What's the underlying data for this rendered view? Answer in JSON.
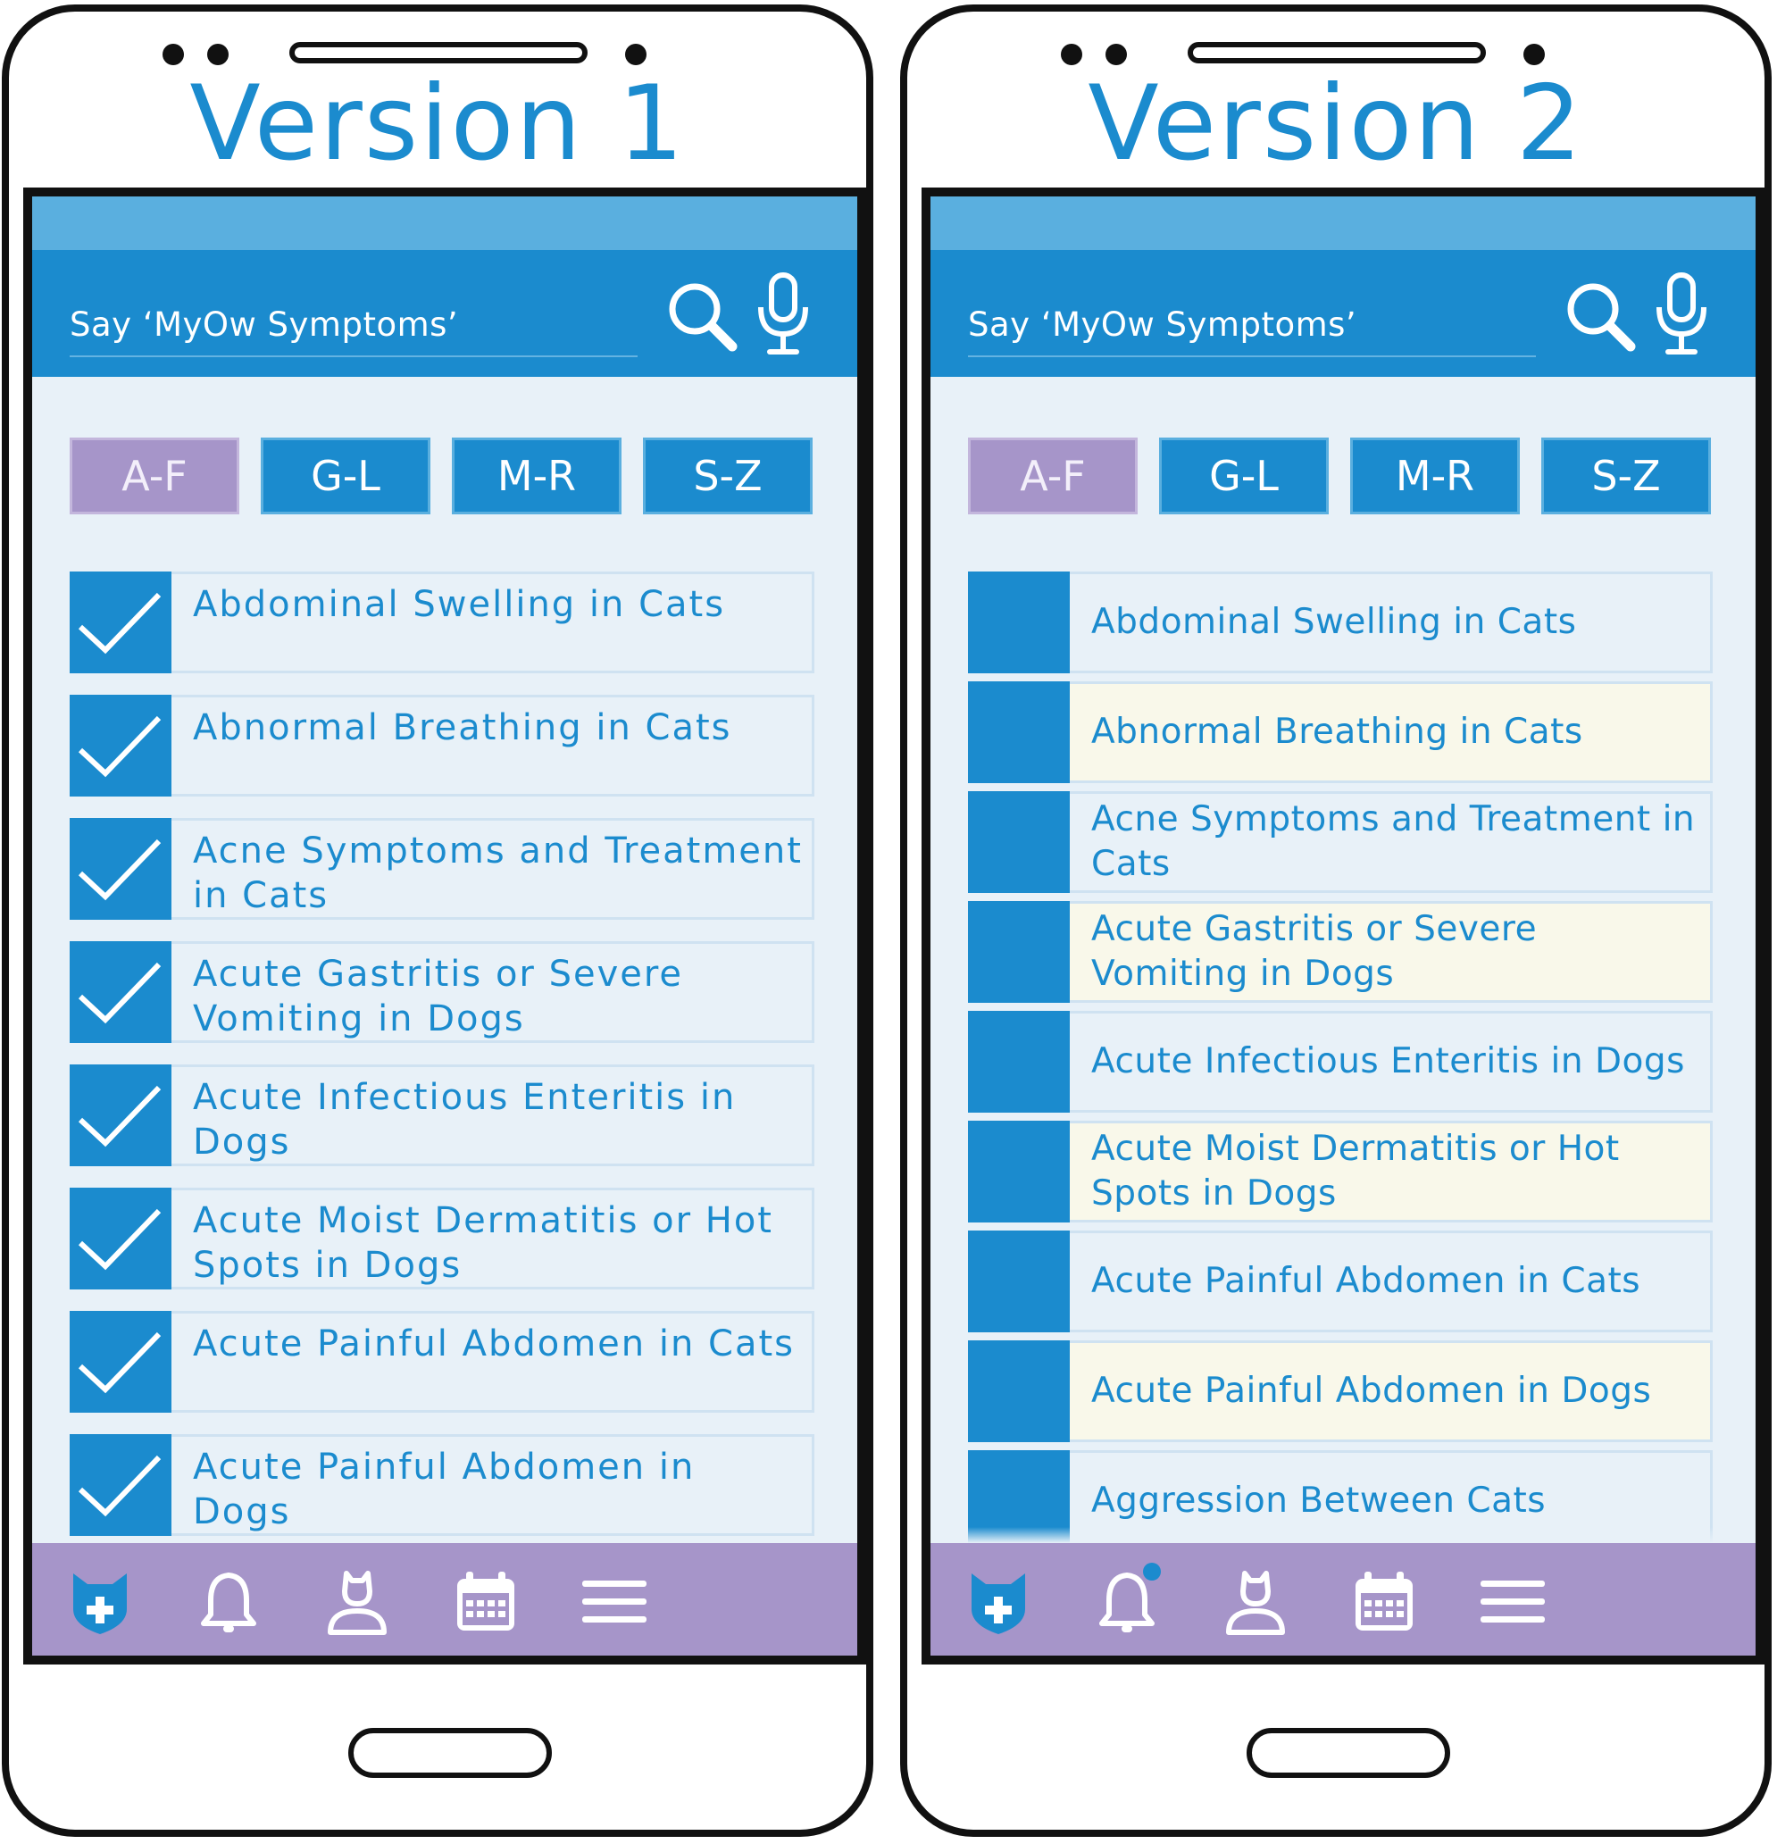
{
  "colors": {
    "brand_blue": "#1b8bce",
    "status_bar_blue": "#5aafdf",
    "list_background": "#e8f1f8",
    "highlight_row": "#f9f8ea",
    "nav_purple": "#a695c9",
    "active_tab_purple": "#a695c9"
  },
  "versions": [
    {
      "title": "Version 1",
      "search": {
        "label": "Say ‘MyOw Symptoms’",
        "search_icon": "search-icon",
        "mic_icon": "microphone-icon"
      },
      "tabs": [
        {
          "label": "A-F",
          "active": true
        },
        {
          "label": "G-L",
          "active": false
        },
        {
          "label": "M-R",
          "active": false
        },
        {
          "label": "S-Z",
          "active": false
        }
      ],
      "items": [
        {
          "label": "Abdominal Swelling in Cats",
          "checked": true
        },
        {
          "label": "Abnormal Breathing in Cats",
          "checked": true
        },
        {
          "label": "Acne Symptoms and Treatment in Cats",
          "checked": true
        },
        {
          "label": "Acute Gastritis or Severe Vomiting in Dogs",
          "checked": true
        },
        {
          "label": "Acute Infectious Enteritis in Dogs",
          "checked": true
        },
        {
          "label": "Acute Moist Dermatitis or Hot Spots in Dogs",
          "checked": true
        },
        {
          "label": "Acute Painful Abdomen in Cats",
          "checked": true
        },
        {
          "label": "Acute Painful Abdomen in Dogs",
          "checked": true
        }
      ],
      "nav": [
        "shield-plus-icon",
        "bell-icon",
        "profile-icon",
        "calendar-icon",
        "menu-icon"
      ]
    },
    {
      "title": "Version 2",
      "search": {
        "label": "Say ‘MyOw Symptoms’",
        "search_icon": "search-icon",
        "mic_icon": "microphone-icon"
      },
      "tabs": [
        {
          "label": "A-F",
          "active": true
        },
        {
          "label": "G-L",
          "active": false
        },
        {
          "label": "M-R",
          "active": false
        },
        {
          "label": "S-Z",
          "active": false
        }
      ],
      "items": [
        {
          "label": "Abdominal Swelling in Cats",
          "highlight": false
        },
        {
          "label": "Abnormal Breathing in Cats",
          "highlight": true
        },
        {
          "label": "Acne Symptoms and Treatment in Cats",
          "highlight": false
        },
        {
          "label": "Acute Gastritis or Severe Vomiting in Dogs",
          "highlight": true
        },
        {
          "label": "Acute Infectious Enteritis in Dogs",
          "highlight": false
        },
        {
          "label": "Acute Moist Dermatitis or Hot Spots in Dogs",
          "highlight": true
        },
        {
          "label": "Acute Painful Abdomen in Cats",
          "highlight": false
        },
        {
          "label": "Acute Painful Abdomen in Dogs",
          "highlight": true
        },
        {
          "label": "Aggression Between Cats",
          "highlight": false
        }
      ],
      "nav": [
        "shield-plus-icon",
        "bell-icon",
        "profile-icon",
        "calendar-icon",
        "menu-icon"
      ],
      "notification_badge": true
    }
  ]
}
